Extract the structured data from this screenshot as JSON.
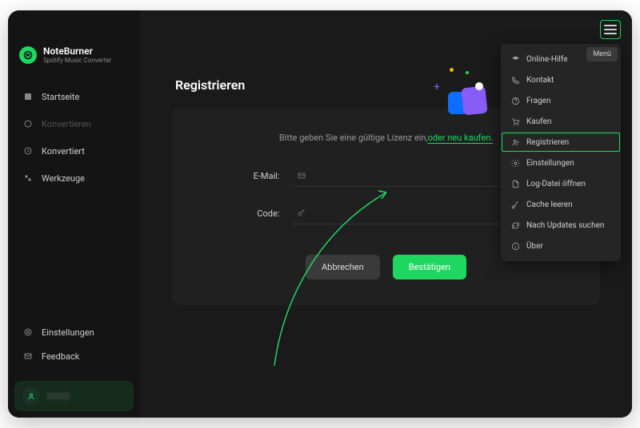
{
  "brand": {
    "name": "NoteBurner",
    "subtitle": "Spotify Music Converter"
  },
  "sidebar": {
    "items": [
      {
        "label": "Startseite",
        "icon": "home-icon"
      },
      {
        "label": "Konvertieren",
        "icon": "convert-icon",
        "dim": true
      },
      {
        "label": "Konvertiert",
        "icon": "clock-icon"
      },
      {
        "label": "Werkzeuge",
        "icon": "tools-icon"
      }
    ],
    "bottom": [
      {
        "label": "Einstellungen",
        "icon": "gear-icon"
      },
      {
        "label": "Feedback",
        "icon": "mail-icon"
      }
    ]
  },
  "page": {
    "title": "Registrieren"
  },
  "form": {
    "help_prefix": "Bitte geben Sie eine gültige Lizenz ein,",
    "help_link": "oder neu kaufen.",
    "email_label": "E-Mail:",
    "code_label": "Code:",
    "email_placeholder": "",
    "code_placeholder": "",
    "cancel": "Abbrechen",
    "confirm": "Bestätigen"
  },
  "menu": {
    "badge": "Menü",
    "items": [
      {
        "label": "Online-Hilfe",
        "icon": "graduation-icon"
      },
      {
        "label": "Kontakt",
        "icon": "phone-icon"
      },
      {
        "label": "Fragen",
        "icon": "question-icon"
      },
      {
        "label": "Kaufen",
        "icon": "cart-icon"
      },
      {
        "label": "Registrieren",
        "icon": "user-plus-icon",
        "highlight": true
      },
      {
        "label": "Einstellungen",
        "icon": "gear-icon"
      },
      {
        "label": "Log-Datei öffnen",
        "icon": "file-icon"
      },
      {
        "label": "Cache leeren",
        "icon": "broom-icon"
      },
      {
        "label": "Nach Updates suchen",
        "icon": "refresh-icon"
      },
      {
        "label": "Über",
        "icon": "info-icon"
      }
    ]
  },
  "colors": {
    "accent": "#1ed760"
  }
}
